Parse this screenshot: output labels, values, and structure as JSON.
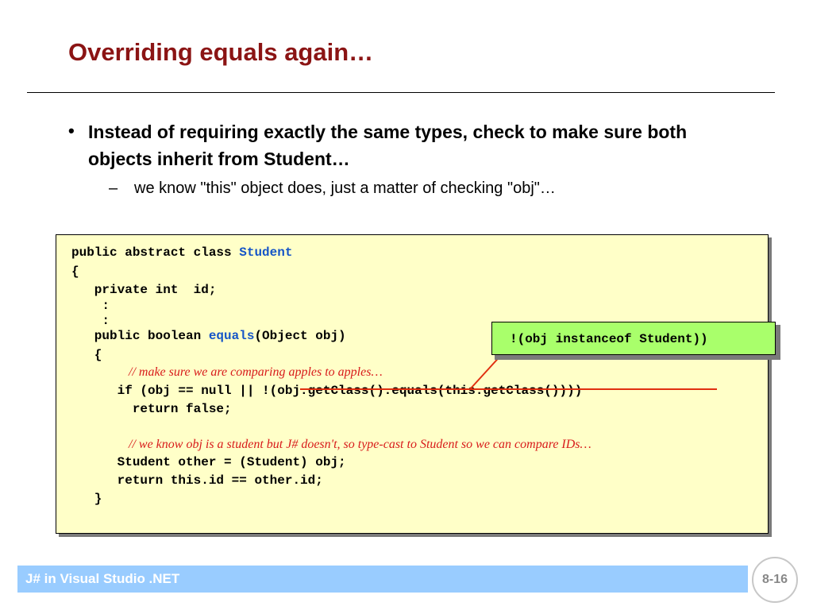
{
  "slide": {
    "title": "Overriding equals again…",
    "bullet": {
      "marker": "•",
      "text": "Instead of requiring exactly the same types, check to make sure both objects inherit from Student…"
    },
    "sub_bullet": {
      "marker": "–",
      "text": "we know \"this\" object does, just a matter of checking \"obj\"…"
    }
  },
  "code": {
    "l1_a": "public abstract class ",
    "l1_b": "Student",
    "l2": "{",
    "l3": "   private int  id;",
    "l4": "    :",
    "l5": "    :",
    "l6_a": "   public boolean ",
    "l6_b": "equals",
    "l6_c": "(Object obj)",
    "l7": "   {",
    "l8": "// make sure we are comparing apples to apples…",
    "l9": "      if (obj == null || !(obj.getClass().equals(this.getClass())))",
    "l10": "        return false;",
    "l11": "// we know obj is a student but J# doesn't, so type-cast to Student so we can compare IDs…",
    "l12": "      Student other = (Student) obj;",
    "l13": "      return this.id == other.id;",
    "l14": "   }"
  },
  "callout": {
    "text": "!(obj instanceof Student))"
  },
  "footer": {
    "text": "J# in Visual Studio .NET",
    "page": "8-16"
  },
  "colors": {
    "title": "#8b1414",
    "keyword_highlight": "#1555c7",
    "comment": "#d81b1b",
    "code_background": "#ffffc8",
    "callout_background": "#a9ff6b",
    "footer_bar": "#99ccff",
    "strike_line": "#e03010"
  }
}
